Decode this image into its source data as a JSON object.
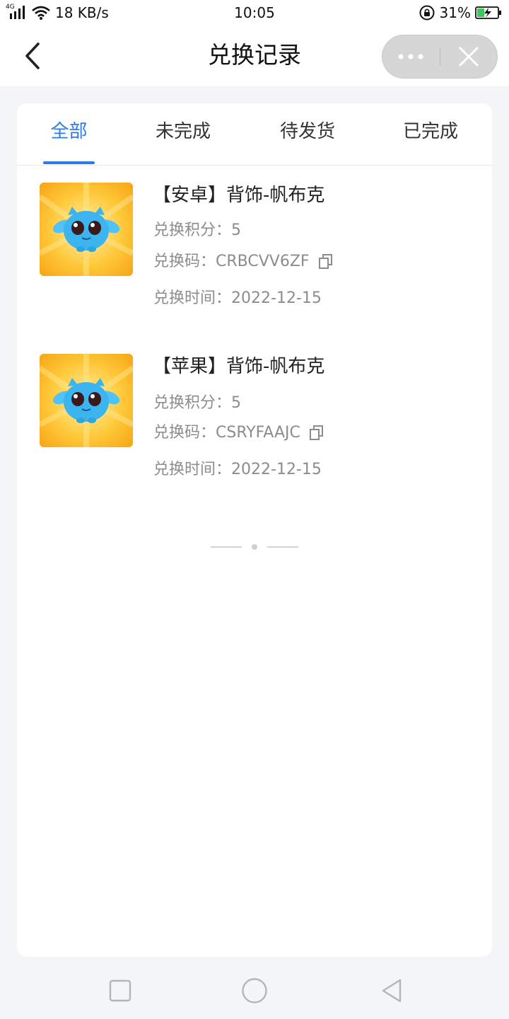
{
  "status_bar": {
    "network_type": "4G",
    "speed": "18 KB/s",
    "time": "10:05",
    "battery": "31%",
    "icons": [
      "signal-icon",
      "wifi-icon",
      "rotation-lock-icon",
      "battery-charging-icon"
    ]
  },
  "header": {
    "title": "兑换记录",
    "back_icon": "chevron-left-icon",
    "more_icon": "more-dots-icon",
    "close_icon": "close-icon"
  },
  "tabs": {
    "items": [
      {
        "label": "全部",
        "active": true
      },
      {
        "label": "未完成",
        "active": false
      },
      {
        "label": "待发货",
        "active": false
      },
      {
        "label": "已完成",
        "active": false
      }
    ],
    "active_color": "#2a7ce8"
  },
  "records": [
    {
      "title": "【安卓】背饰-帆布克",
      "points_label": "兑换积分：",
      "points": "5",
      "code_label": "兑换码：",
      "code": "CRBCVV6ZF",
      "time_label": "兑换时间：",
      "time": "2022-12-15"
    },
    {
      "title": "【苹果】背饰-帆布克",
      "points_label": "兑换积分：",
      "points": "5",
      "code_label": "兑换码：",
      "code": "CSRYFAAJC",
      "time_label": "兑换时间：",
      "time": "2022-12-15"
    }
  ],
  "nav_bar": {
    "icons": [
      "recent-apps-square-icon",
      "home-circle-icon",
      "back-triangle-icon"
    ]
  }
}
